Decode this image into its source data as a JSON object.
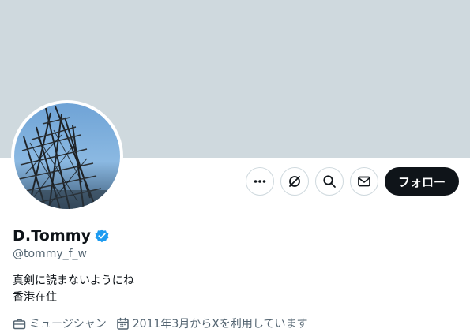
{
  "profile": {
    "display_name": "D.Tommy",
    "handle": "@tommy_f_w",
    "bio_lines": [
      "真剣に読まないようにね",
      "香港在住"
    ],
    "profession": "ミュージシャン",
    "joined": "2011年3月からXを利用しています"
  },
  "actions": {
    "follow_label": "フォロー",
    "more_icon": "more-icon",
    "grok_icon": "grok-icon",
    "search_icon": "search-icon",
    "message_icon": "envelope-icon"
  },
  "colors": {
    "banner": "#cfd9de",
    "verified": "#1d9bf0",
    "follow_bg": "#0f1419",
    "secondary_text": "#536471"
  }
}
